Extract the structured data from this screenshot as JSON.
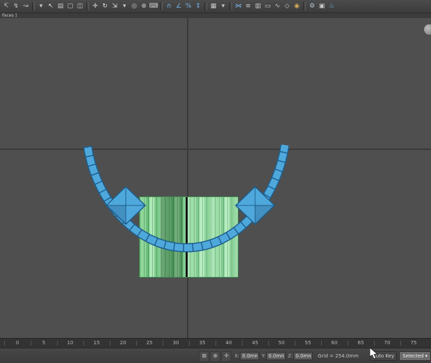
{
  "toolbar": {
    "icons": [
      {
        "name": "select-and-link-icon",
        "glyph": "↸",
        "color": "#c9c9c9"
      },
      {
        "name": "unlink-selection-icon",
        "glyph": "↯",
        "color": "#c9c9c9"
      },
      {
        "name": "bind-to-space-warp-icon",
        "glyph": "↝",
        "color": "#c9c9c9",
        "sep_after": true
      },
      {
        "name": "selection-filter-dropdown-icon",
        "glyph": "▾",
        "color": "#c9c9c9"
      },
      {
        "name": "select-object-icon",
        "glyph": "↖",
        "color": "#e6e6e6"
      },
      {
        "name": "select-by-name-icon",
        "glyph": "▤",
        "color": "#c9c9c9"
      },
      {
        "name": "selection-region-icon",
        "glyph": "▢",
        "color": "#c9c9c9"
      },
      {
        "name": "window-crossing-icon",
        "glyph": "◫",
        "color": "#c9c9c9",
        "sep_after": true
      },
      {
        "name": "select-and-move-icon",
        "glyph": "✛",
        "color": "#e6e6e6"
      },
      {
        "name": "select-and-rotate-icon",
        "glyph": "↻",
        "color": "#e6e6e6"
      },
      {
        "name": "select-and-scale-icon",
        "glyph": "⇲",
        "color": "#e6e6e6"
      },
      {
        "name": "reference-coordinate-dropdown-icon",
        "glyph": "▾",
        "color": "#c9c9c9"
      },
      {
        "name": "use-center-icon",
        "glyph": "◎",
        "color": "#c9c9c9"
      },
      {
        "name": "select-and-manipulate-icon",
        "glyph": "⊕",
        "color": "#c9c9c9"
      },
      {
        "name": "keyboard-override-icon",
        "glyph": "⌨",
        "color": "#c9c9c9",
        "sep_after": true
      },
      {
        "name": "snap-toggle-3d-icon",
        "glyph": "∩",
        "color": "#7ab7e8"
      },
      {
        "name": "angle-snap-icon",
        "glyph": "∠",
        "color": "#7ab7e8"
      },
      {
        "name": "percent-snap-icon",
        "glyph": "%",
        "color": "#7ab7e8"
      },
      {
        "name": "spinner-snap-icon",
        "glyph": "↕",
        "color": "#7ab7e8",
        "sep_after": true
      },
      {
        "name": "edit-named-selection-sets-icon",
        "glyph": "▦",
        "color": "#c9c9c9"
      },
      {
        "name": "named-selection-dropdown-icon",
        "glyph": "▾",
        "color": "#c9c9c9",
        "sep_after": true
      },
      {
        "name": "mirror-icon",
        "glyph": "⋈",
        "color": "#7ab7e8"
      },
      {
        "name": "align-icon",
        "glyph": "≡",
        "color": "#c9c9c9"
      },
      {
        "name": "layer-manager-icon",
        "glyph": "▥",
        "color": "#c9c9c9"
      },
      {
        "name": "ribbon-toggle-icon",
        "glyph": "▭",
        "color": "#c9c9c9"
      },
      {
        "name": "curve-editor-icon",
        "glyph": "∿",
        "color": "#c9c9c9"
      },
      {
        "name": "schematic-view-icon",
        "glyph": "◇",
        "color": "#c9c9c9"
      },
      {
        "name": "material-editor-icon",
        "glyph": "◉",
        "color": "#d8a85a",
        "sep_after": true
      },
      {
        "name": "render-setup-icon",
        "glyph": "⚙",
        "color": "#b8c8d8"
      },
      {
        "name": "rendered-frame-window-icon",
        "glyph": "▣",
        "color": "#c9c9c9"
      },
      {
        "name": "render-production-icon",
        "glyph": "♨",
        "color": "#7ab7e8"
      }
    ]
  },
  "viewport": {
    "label": "Faces ]",
    "background": "#4f4f4f",
    "axis_color": "#3a3a3a",
    "model_colors": {
      "band_fill": "#4fa8dc",
      "band_edge": "#1e5f8e",
      "box_base": "#8ed69a",
      "box_edge": "#3e8a4e",
      "box_dark_line": "#141414"
    }
  },
  "timeline": {
    "labels": [
      "0",
      "5",
      "10",
      "15",
      "20",
      "25",
      "30",
      "35",
      "40",
      "45",
      "50",
      "55",
      "60",
      "65",
      "70",
      "75"
    ]
  },
  "statusbar": {
    "icons": [
      {
        "name": "selection-lock-icon",
        "glyph": "⊠"
      },
      {
        "name": "absolute-offset-toggle-icon",
        "glyph": "⊕"
      },
      {
        "name": "transform-type-in-icon",
        "glyph": "✛"
      }
    ],
    "coords": [
      {
        "label": "X:",
        "value": "0.0mm"
      },
      {
        "label": "Y:",
        "value": "0.0mm"
      },
      {
        "label": "Z:",
        "value": "0.0mm"
      }
    ],
    "grid_label": "Grid = 254.0mm",
    "auto_key_label": "Auto Key",
    "selected_label": "Selected",
    "selected_arrow": "▾"
  }
}
